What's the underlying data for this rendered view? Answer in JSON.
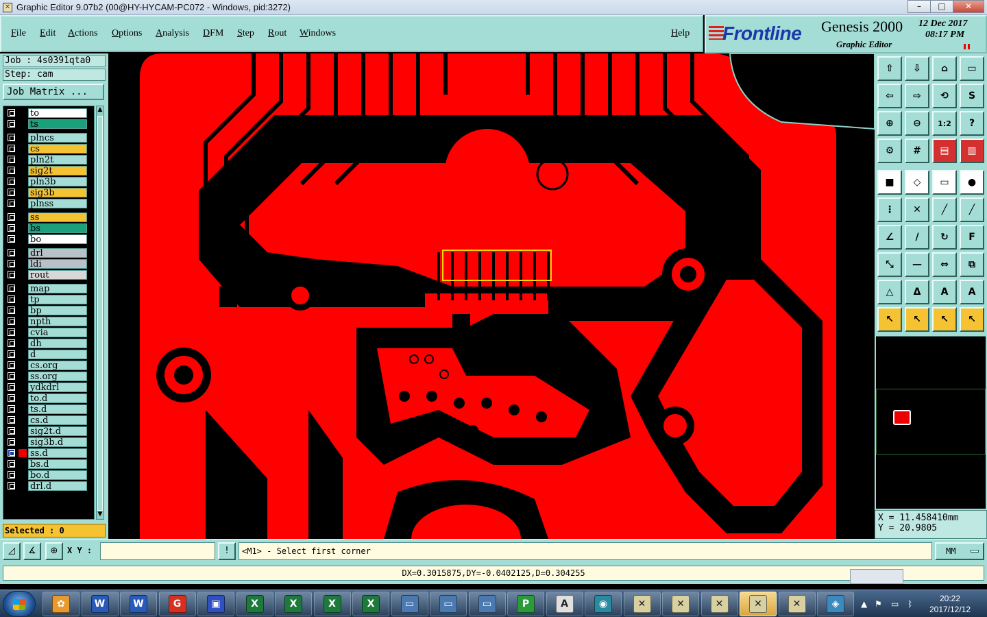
{
  "window": {
    "title": "Graphic Editor 9.07b2 (00@HY-HYCAM-PC072 - Windows, pid:3272)",
    "controls": [
      "–",
      "□",
      "✕"
    ]
  },
  "menu": {
    "items": [
      "File",
      "Edit",
      "Actions",
      "Options",
      "Analysis",
      "DFM",
      "Step",
      "Rout",
      "Windows"
    ],
    "help": "Help"
  },
  "logo": {
    "brand": "Frontline",
    "product": "Genesis 2000",
    "subtitle": "Graphic Editor",
    "date": "12 Dec 2017",
    "time": "08:17 PM"
  },
  "job": {
    "job_label": "Job : 4s0391qta0",
    "step_label": "Step: cam",
    "matrix_button": "Job Matrix ...",
    "selected": "Selected : 0"
  },
  "layers": [
    {
      "name": "to",
      "color": "#ffffff"
    },
    {
      "name": "ts",
      "color": "#1aa07a"
    },
    {
      "name": "plncs",
      "color": "#a4dcd6"
    },
    {
      "name": "cs",
      "color": "#f5c232"
    },
    {
      "name": "pln2t",
      "color": "#a4dcd6"
    },
    {
      "name": "sig2t",
      "color": "#f5c232"
    },
    {
      "name": "pln3b",
      "color": "#a4dcd6"
    },
    {
      "name": "sig3b",
      "color": "#f5c232"
    },
    {
      "name": "plnss",
      "color": "#a4dcd6"
    },
    {
      "name": "ss",
      "color": "#f5c232"
    },
    {
      "name": "bs",
      "color": "#1aa07a"
    },
    {
      "name": "bo",
      "color": "#ffffff"
    },
    {
      "name": "drl",
      "color": "#b8c0c8"
    },
    {
      "name": "ldi",
      "color": "#b8c0c8"
    },
    {
      "name": "rout",
      "color": "#d8d8d8"
    },
    {
      "name": "map",
      "color": "#a4dcd6"
    },
    {
      "name": "tp",
      "color": "#a4dcd6"
    },
    {
      "name": "bp",
      "color": "#a4dcd6"
    },
    {
      "name": "npth",
      "color": "#a4dcd6"
    },
    {
      "name": "cvia",
      "color": "#a4dcd6"
    },
    {
      "name": "dh",
      "color": "#a4dcd6"
    },
    {
      "name": "d",
      "color": "#a4dcd6"
    },
    {
      "name": "cs.org",
      "color": "#a4dcd6"
    },
    {
      "name": "ss.org",
      "color": "#a4dcd6"
    },
    {
      "name": "ydkdrl",
      "color": "#a4dcd6"
    },
    {
      "name": "to.d",
      "color": "#a4dcd6"
    },
    {
      "name": "ts.d",
      "color": "#a4dcd6"
    },
    {
      "name": "cs.d",
      "color": "#a4dcd6"
    },
    {
      "name": "sig2t.d",
      "color": "#a4dcd6"
    },
    {
      "name": "sig3b.d",
      "color": "#a4dcd6"
    },
    {
      "name": "ss.d",
      "color": "#a4dcd6",
      "active": true
    },
    {
      "name": "bs.d",
      "color": "#a4dcd6"
    },
    {
      "name": "bo.d",
      "color": "#a4dcd6"
    },
    {
      "name": "drl.d",
      "color": "#a4dcd6"
    }
  ],
  "toolbar": {
    "tools": [
      {
        "icon": "zoom-home-icon",
        "glyph": "⇧",
        "style": "c"
      },
      {
        "icon": "zoom-down-icon",
        "glyph": "⇩",
        "style": "c"
      },
      {
        "icon": "zoom-fit-icon",
        "glyph": "⌂",
        "style": "c"
      },
      {
        "icon": "zoom-window-icon",
        "glyph": "▭",
        "style": "c"
      },
      {
        "icon": "pan-left-icon",
        "glyph": "⇦",
        "style": "c"
      },
      {
        "icon": "pan-right-icon",
        "glyph": "⇨",
        "style": "c"
      },
      {
        "icon": "mirror-icon",
        "glyph": "⟲",
        "style": "c"
      },
      {
        "icon": "snap-icon",
        "glyph": "S",
        "style": "c"
      },
      {
        "icon": "zoom-in-icon",
        "glyph": "⊕",
        "style": "c"
      },
      {
        "icon": "zoom-out-icon",
        "glyph": "⊖",
        "style": "c"
      },
      {
        "icon": "scale-icon",
        "glyph": "1:2",
        "style": "c"
      },
      {
        "icon": "help-icon",
        "glyph": "?",
        "style": "c"
      },
      {
        "icon": "settings-icon",
        "glyph": "⚙",
        "style": "c"
      },
      {
        "icon": "grid-icon",
        "glyph": "#",
        "style": "c"
      },
      {
        "icon": "layers-red-icon",
        "glyph": "▤",
        "style": "r"
      },
      {
        "icon": "layers-alt-icon",
        "glyph": "▥",
        "style": "r"
      },
      {
        "icon": "pad-icon",
        "glyph": "■",
        "style": "w"
      },
      {
        "icon": "edit-shape-icon",
        "glyph": "◇",
        "style": "w"
      },
      {
        "icon": "ruler-icon",
        "glyph": "▭",
        "style": "w"
      },
      {
        "icon": "dot-icon",
        "glyph": "●",
        "style": "w"
      },
      {
        "icon": "nodes-icon",
        "glyph": "⋮",
        "style": "c"
      },
      {
        "icon": "cross-icon",
        "glyph": "✕",
        "style": "c"
      },
      {
        "icon": "line-icon",
        "glyph": "╱",
        "style": "c"
      },
      {
        "icon": "line-alt-icon",
        "glyph": "╱",
        "style": "c"
      },
      {
        "icon": "angle-icon",
        "glyph": "∠",
        "style": "c"
      },
      {
        "icon": "slash-icon",
        "glyph": "/",
        "style": "c"
      },
      {
        "icon": "arc-icon",
        "glyph": "↻",
        "style": "c"
      },
      {
        "icon": "fill-icon",
        "glyph": "F",
        "style": "c"
      },
      {
        "icon": "move-icon",
        "glyph": "⤡",
        "style": "c"
      },
      {
        "icon": "split-icon",
        "glyph": "—",
        "style": "c"
      },
      {
        "icon": "resize-icon",
        "glyph": "⇔",
        "style": "c"
      },
      {
        "icon": "group-icon",
        "glyph": "⧉",
        "style": "c"
      },
      {
        "icon": "triangle-icon",
        "glyph": "△",
        "style": "c"
      },
      {
        "icon": "measure-icon",
        "glyph": "Δ",
        "style": "c"
      },
      {
        "icon": "arrow-up-icon",
        "glyph": "A",
        "style": "c"
      },
      {
        "icon": "text-icon",
        "glyph": "A",
        "style": "c"
      },
      {
        "icon": "select-icon",
        "glyph": "↖",
        "style": "y"
      },
      {
        "icon": "select-box-icon",
        "glyph": "↖",
        "style": "y"
      },
      {
        "icon": "select-lasso-icon",
        "glyph": "↖",
        "style": "y"
      },
      {
        "icon": "select-net-icon",
        "glyph": "↖",
        "style": "y"
      }
    ]
  },
  "coords": {
    "x": "X = 11.458410mm",
    "y": "Y = 20.9805"
  },
  "command": {
    "xy_label": "X Y :",
    "xy_value": "",
    "prompt": "<M1> - Select first corner",
    "units": "MM",
    "status": "DX=0.3015875,DY=-0.0402125,D=0.304255"
  },
  "taskbar": {
    "apps": [
      {
        "icon": "explorer-icon",
        "glyph": "✿",
        "color": "#e89a30"
      },
      {
        "icon": "word-icon",
        "glyph": "W",
        "color": "#2a5ab8"
      },
      {
        "icon": "word-icon",
        "glyph": "W",
        "color": "#2a5ab8"
      },
      {
        "icon": "app-g-icon",
        "glyph": "G",
        "color": "#d83020"
      },
      {
        "icon": "floppy-icon",
        "glyph": "▣",
        "color": "#3050c0"
      },
      {
        "icon": "excel-icon",
        "glyph": "X",
        "color": "#1e7a3c"
      },
      {
        "icon": "excel-icon",
        "glyph": "X",
        "color": "#1e7a3c"
      },
      {
        "icon": "excel-icon",
        "glyph": "X",
        "color": "#1e7a3c"
      },
      {
        "icon": "excel-icon",
        "glyph": "X",
        "color": "#1e7a3c"
      },
      {
        "icon": "monitor-icon",
        "glyph": "▭",
        "color": "#4a7ab0"
      },
      {
        "icon": "monitor-icon",
        "glyph": "▭",
        "color": "#4a7ab0"
      },
      {
        "icon": "monitor-icon",
        "glyph": "▭",
        "color": "#4a7ab0"
      },
      {
        "icon": "app-p-icon",
        "glyph": "P",
        "color": "#2a9a3a"
      },
      {
        "icon": "document-icon",
        "glyph": "A",
        "color": "#e0e0e0"
      },
      {
        "icon": "eye-icon",
        "glyph": "◉",
        "color": "#2a8aa0"
      },
      {
        "icon": "genesis-icon",
        "glyph": "✕",
        "color": "#d8d0a0"
      },
      {
        "icon": "genesis-icon",
        "glyph": "✕",
        "color": "#d8d0a0"
      },
      {
        "icon": "genesis-icon",
        "glyph": "✕",
        "color": "#d8d0a0"
      },
      {
        "icon": "genesis-icon",
        "glyph": "✕",
        "color": "#d8d0a0",
        "active": true
      },
      {
        "icon": "genesis-icon",
        "glyph": "✕",
        "color": "#d8d0a0"
      },
      {
        "icon": "network-icon",
        "glyph": "◈",
        "color": "#3a8ac0"
      }
    ],
    "clock_time": "20:22",
    "clock_date": "2017/12/12"
  }
}
